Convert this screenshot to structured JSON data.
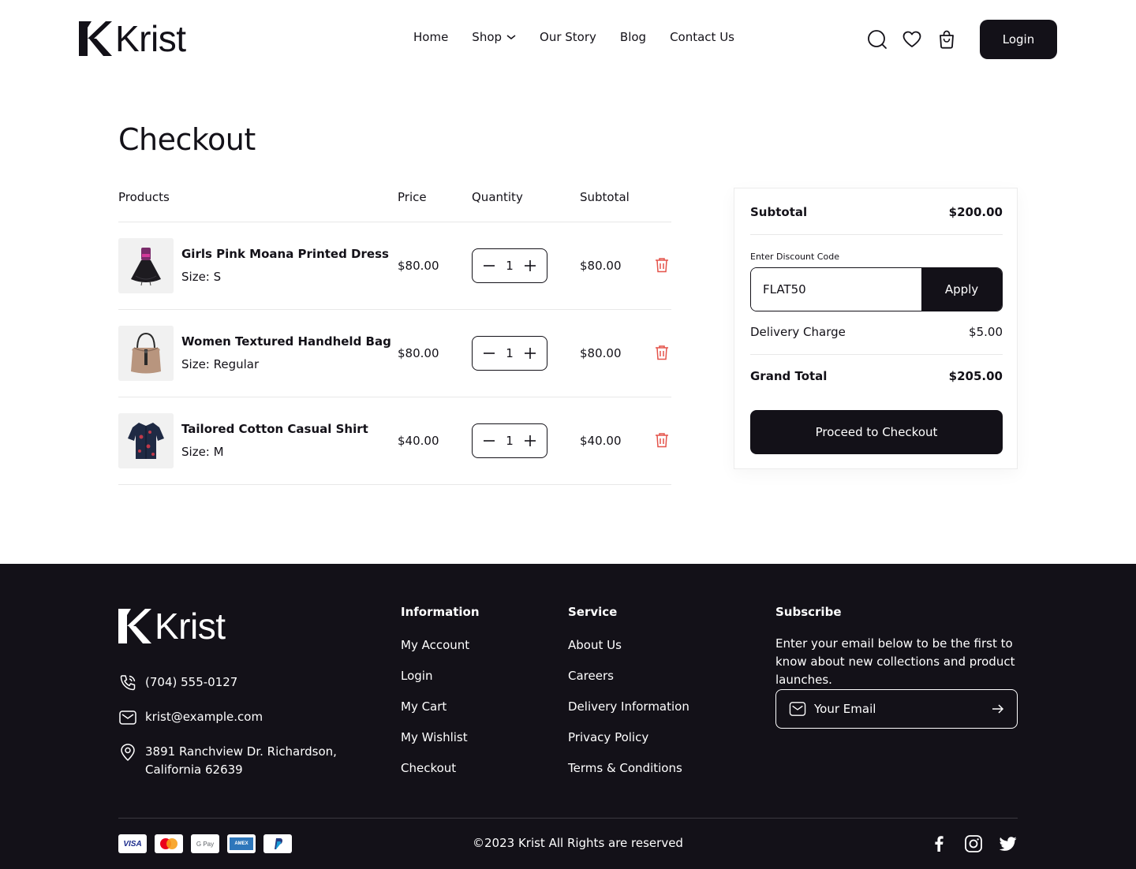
{
  "brand": {
    "name": "Krist"
  },
  "nav": {
    "items": [
      {
        "label": "Home"
      },
      {
        "label": "Shop"
      },
      {
        "label": "Our Story"
      },
      {
        "label": "Blog"
      },
      {
        "label": "Contact Us"
      }
    ],
    "login_label": "Login",
    "icons": [
      "search-icon",
      "heart-icon",
      "shopping-bag-icon"
    ]
  },
  "page": {
    "title": "Checkout"
  },
  "cart": {
    "headers": {
      "products": "Products",
      "price": "Price",
      "quantity": "Quantity",
      "subtotal": "Subtotal"
    },
    "items": [
      {
        "name": "Girls Pink Moana Printed Dress",
        "size": "Size: S",
        "price": "$80.00",
        "qty": "1",
        "subtotal": "$80.00"
      },
      {
        "name": "Women Textured Handheld Bag",
        "size": "Size: Regular",
        "price": "$80.00",
        "qty": "1",
        "subtotal": "$80.00"
      },
      {
        "name": "Tailored Cotton Casual Shirt",
        "size": "Size: M",
        "price": "$40.00",
        "qty": "1",
        "subtotal": "$40.00"
      }
    ]
  },
  "summary": {
    "subtotal_label": "Subtotal",
    "subtotal_value": "$200.00",
    "discount_label": "Enter Discount Code",
    "discount_value": "FLAT50",
    "apply_label": "Apply",
    "delivery_label": "Delivery Charge",
    "delivery_value": "$5.00",
    "total_label": "Grand Total",
    "total_value": "$205.00",
    "checkout_label": "Proceed to Checkout"
  },
  "footer": {
    "phone": "(704) 555-0127",
    "email": "krist@example.com",
    "address_line1": "3891 Ranchview Dr. Richardson,",
    "address_line2": "California 62639",
    "information": {
      "title": "Information",
      "links": [
        "My Account",
        "Login",
        "My Cart",
        "My Wishlist",
        "Checkout"
      ]
    },
    "service": {
      "title": "Service",
      "links": [
        "About Us",
        "Careers",
        "Delivery Information",
        "Privacy Policy",
        "Terms & Conditions"
      ]
    },
    "subscribe": {
      "title": "Subscribe",
      "text": "Enter your email below to be the first to know about new collections and product launches.",
      "placeholder": "Your Email"
    },
    "payments": [
      "VISA",
      "Mastercard",
      "G Pay",
      "AMEX",
      "PayPal"
    ],
    "copyright": "©2023 Krist All Rights are reserved",
    "socials": [
      "facebook-icon",
      "instagram-icon",
      "twitter-icon"
    ]
  },
  "colors": {
    "primary": "#131118",
    "danger": "#e4534a",
    "border": "#e8e8e8"
  }
}
